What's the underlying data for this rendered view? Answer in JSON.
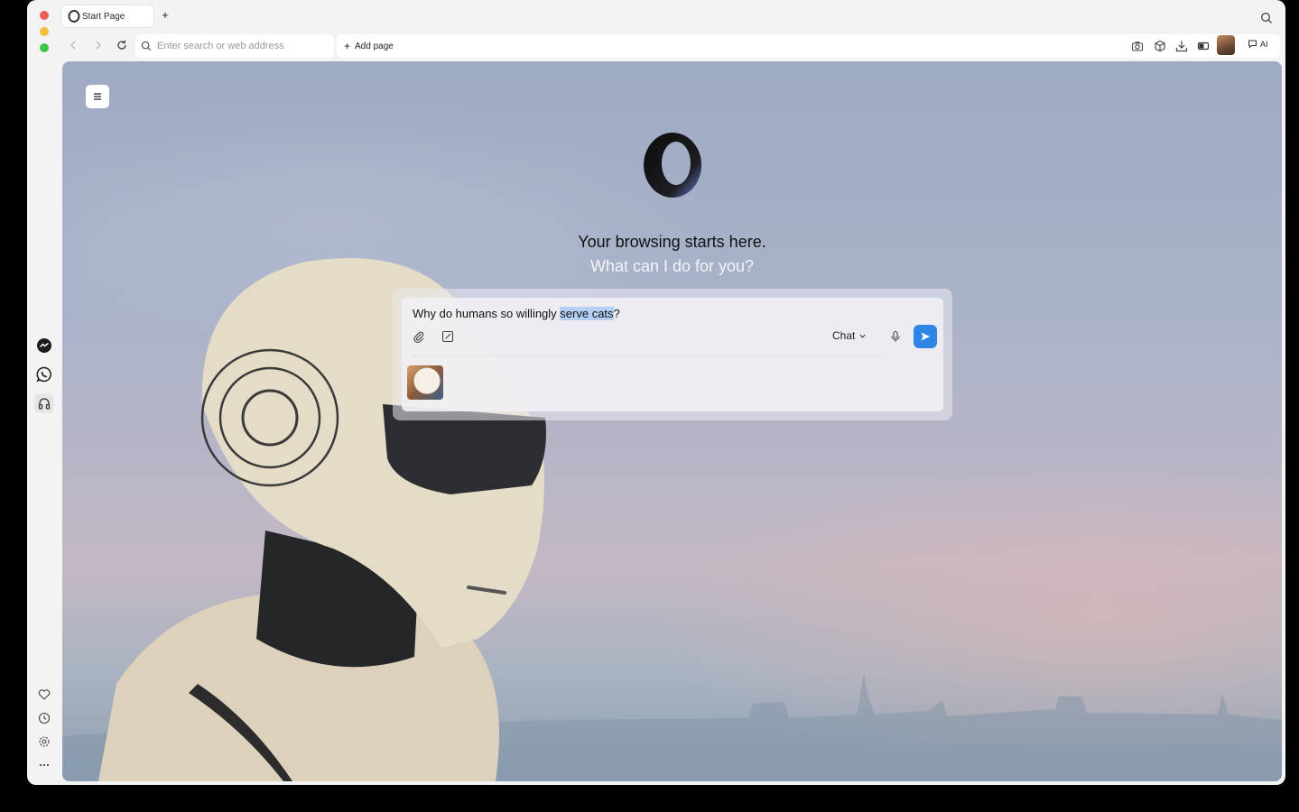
{
  "tabs": [
    {
      "title": "Start Page"
    }
  ],
  "address_bar": {
    "placeholder": "Enter search or web address",
    "add_page_label": "Add page"
  },
  "toolbar": {
    "ai_label": "AI"
  },
  "start_page": {
    "headline": "Your browsing starts here.",
    "subline": "What can I do for you?"
  },
  "chat_box": {
    "query_prefix": "Why do humans so willingly ",
    "query_selected": "serve cats",
    "query_suffix": "?",
    "mode_label": "Chat"
  },
  "colors": {
    "accent": "#2d86e6",
    "selection": "#b5d0f5"
  },
  "icons": {
    "sidebar_top": [
      "messenger-icon",
      "whatsapp-icon",
      "music-player-icon"
    ],
    "sidebar_bottom": [
      "heart-icon",
      "history-icon",
      "settings-icon",
      "more-icon"
    ],
    "toolbar": [
      "camera-icon",
      "cube-icon",
      "download-icon",
      "battery-saver-icon",
      "chat-bubble-icon"
    ]
  }
}
